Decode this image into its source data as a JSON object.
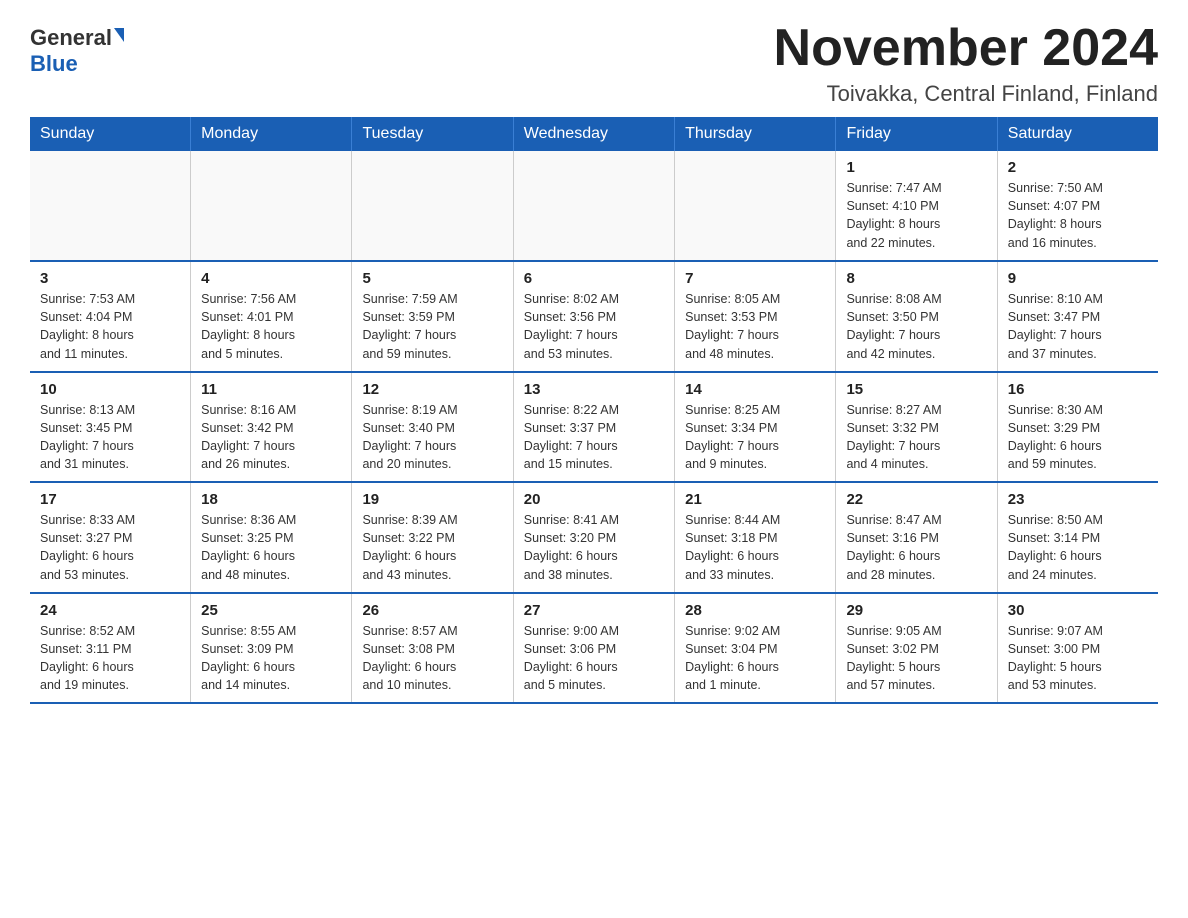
{
  "logo": {
    "general": "General",
    "blue": "Blue"
  },
  "title": "November 2024",
  "subtitle": "Toivakka, Central Finland, Finland",
  "header": {
    "days": [
      "Sunday",
      "Monday",
      "Tuesday",
      "Wednesday",
      "Thursday",
      "Friday",
      "Saturday"
    ]
  },
  "weeks": [
    {
      "cells": [
        {
          "day": "",
          "info": ""
        },
        {
          "day": "",
          "info": ""
        },
        {
          "day": "",
          "info": ""
        },
        {
          "day": "",
          "info": ""
        },
        {
          "day": "",
          "info": ""
        },
        {
          "day": "1",
          "info": "Sunrise: 7:47 AM\nSunset: 4:10 PM\nDaylight: 8 hours\nand 22 minutes."
        },
        {
          "day": "2",
          "info": "Sunrise: 7:50 AM\nSunset: 4:07 PM\nDaylight: 8 hours\nand 16 minutes."
        }
      ]
    },
    {
      "cells": [
        {
          "day": "3",
          "info": "Sunrise: 7:53 AM\nSunset: 4:04 PM\nDaylight: 8 hours\nand 11 minutes."
        },
        {
          "day": "4",
          "info": "Sunrise: 7:56 AM\nSunset: 4:01 PM\nDaylight: 8 hours\nand 5 minutes."
        },
        {
          "day": "5",
          "info": "Sunrise: 7:59 AM\nSunset: 3:59 PM\nDaylight: 7 hours\nand 59 minutes."
        },
        {
          "day": "6",
          "info": "Sunrise: 8:02 AM\nSunset: 3:56 PM\nDaylight: 7 hours\nand 53 minutes."
        },
        {
          "day": "7",
          "info": "Sunrise: 8:05 AM\nSunset: 3:53 PM\nDaylight: 7 hours\nand 48 minutes."
        },
        {
          "day": "8",
          "info": "Sunrise: 8:08 AM\nSunset: 3:50 PM\nDaylight: 7 hours\nand 42 minutes."
        },
        {
          "day": "9",
          "info": "Sunrise: 8:10 AM\nSunset: 3:47 PM\nDaylight: 7 hours\nand 37 minutes."
        }
      ]
    },
    {
      "cells": [
        {
          "day": "10",
          "info": "Sunrise: 8:13 AM\nSunset: 3:45 PM\nDaylight: 7 hours\nand 31 minutes."
        },
        {
          "day": "11",
          "info": "Sunrise: 8:16 AM\nSunset: 3:42 PM\nDaylight: 7 hours\nand 26 minutes."
        },
        {
          "day": "12",
          "info": "Sunrise: 8:19 AM\nSunset: 3:40 PM\nDaylight: 7 hours\nand 20 minutes."
        },
        {
          "day": "13",
          "info": "Sunrise: 8:22 AM\nSunset: 3:37 PM\nDaylight: 7 hours\nand 15 minutes."
        },
        {
          "day": "14",
          "info": "Sunrise: 8:25 AM\nSunset: 3:34 PM\nDaylight: 7 hours\nand 9 minutes."
        },
        {
          "day": "15",
          "info": "Sunrise: 8:27 AM\nSunset: 3:32 PM\nDaylight: 7 hours\nand 4 minutes."
        },
        {
          "day": "16",
          "info": "Sunrise: 8:30 AM\nSunset: 3:29 PM\nDaylight: 6 hours\nand 59 minutes."
        }
      ]
    },
    {
      "cells": [
        {
          "day": "17",
          "info": "Sunrise: 8:33 AM\nSunset: 3:27 PM\nDaylight: 6 hours\nand 53 minutes."
        },
        {
          "day": "18",
          "info": "Sunrise: 8:36 AM\nSunset: 3:25 PM\nDaylight: 6 hours\nand 48 minutes."
        },
        {
          "day": "19",
          "info": "Sunrise: 8:39 AM\nSunset: 3:22 PM\nDaylight: 6 hours\nand 43 minutes."
        },
        {
          "day": "20",
          "info": "Sunrise: 8:41 AM\nSunset: 3:20 PM\nDaylight: 6 hours\nand 38 minutes."
        },
        {
          "day": "21",
          "info": "Sunrise: 8:44 AM\nSunset: 3:18 PM\nDaylight: 6 hours\nand 33 minutes."
        },
        {
          "day": "22",
          "info": "Sunrise: 8:47 AM\nSunset: 3:16 PM\nDaylight: 6 hours\nand 28 minutes."
        },
        {
          "day": "23",
          "info": "Sunrise: 8:50 AM\nSunset: 3:14 PM\nDaylight: 6 hours\nand 24 minutes."
        }
      ]
    },
    {
      "cells": [
        {
          "day": "24",
          "info": "Sunrise: 8:52 AM\nSunset: 3:11 PM\nDaylight: 6 hours\nand 19 minutes."
        },
        {
          "day": "25",
          "info": "Sunrise: 8:55 AM\nSunset: 3:09 PM\nDaylight: 6 hours\nand 14 minutes."
        },
        {
          "day": "26",
          "info": "Sunrise: 8:57 AM\nSunset: 3:08 PM\nDaylight: 6 hours\nand 10 minutes."
        },
        {
          "day": "27",
          "info": "Sunrise: 9:00 AM\nSunset: 3:06 PM\nDaylight: 6 hours\nand 5 minutes."
        },
        {
          "day": "28",
          "info": "Sunrise: 9:02 AM\nSunset: 3:04 PM\nDaylight: 6 hours\nand 1 minute."
        },
        {
          "day": "29",
          "info": "Sunrise: 9:05 AM\nSunset: 3:02 PM\nDaylight: 5 hours\nand 57 minutes."
        },
        {
          "day": "30",
          "info": "Sunrise: 9:07 AM\nSunset: 3:00 PM\nDaylight: 5 hours\nand 53 minutes."
        }
      ]
    }
  ]
}
